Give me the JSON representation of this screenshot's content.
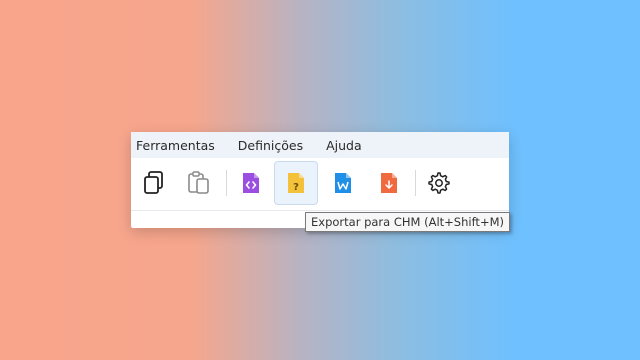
{
  "menu": {
    "items": [
      "Ferramentas",
      "Definições",
      "Ajuda"
    ]
  },
  "toolbar": {
    "buttons": [
      {
        "icon": "copy-icon",
        "state": "enabled"
      },
      {
        "icon": "paste-icon",
        "state": "disabled"
      },
      {
        "icon": "export-html-icon",
        "color": "#9b4fe0"
      },
      {
        "icon": "export-chm-icon",
        "color": "#f3c13a",
        "state": "hover"
      },
      {
        "icon": "export-word-icon",
        "color": "#1f8fe8"
      },
      {
        "icon": "export-pdf-icon",
        "color": "#f06a3f"
      },
      {
        "icon": "settings-icon"
      }
    ],
    "tooltip": "Exportar para CHM (Alt+Shift+M)"
  }
}
